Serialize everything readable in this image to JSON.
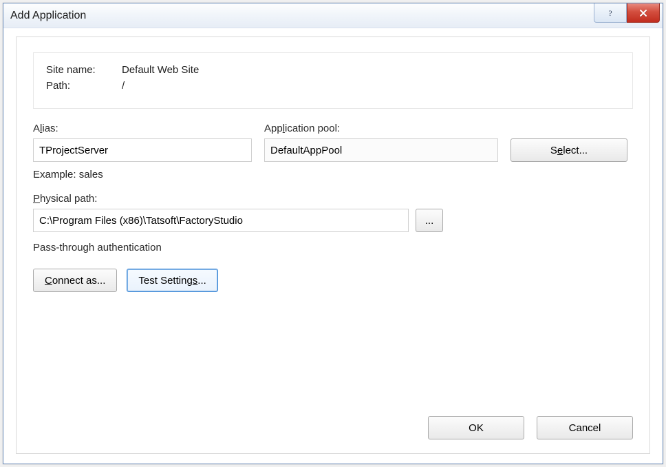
{
  "window": {
    "title": "Add Application"
  },
  "info": {
    "sitename_label": "Site name:",
    "sitename_value": "Default Web Site",
    "path_label": "Path:",
    "path_value": "/"
  },
  "alias": {
    "label_pre": "A",
    "label_u": "l",
    "label_post": "ias:",
    "value": "TProjectServer",
    "hint": "Example: sales"
  },
  "apppool": {
    "label_pre": "App",
    "label_u": "l",
    "label_post": "ication pool:",
    "value": "DefaultAppPool"
  },
  "select_btn": {
    "pre": "S",
    "u": "e",
    "post": "lect..."
  },
  "physical": {
    "label_pre": "",
    "label_u": "P",
    "label_post": "hysical path:",
    "value": "C:\\Program Files (x86)\\Tatsoft\\FactoryStudio",
    "browse": "..."
  },
  "auth": {
    "label": "Pass-through authentication"
  },
  "connect_btn": {
    "u": "C",
    "post": "onnect as..."
  },
  "test_btn": {
    "pre": "Test Setting",
    "u": "s",
    "post": "..."
  },
  "footer": {
    "ok": "OK",
    "cancel": "Cancel"
  }
}
